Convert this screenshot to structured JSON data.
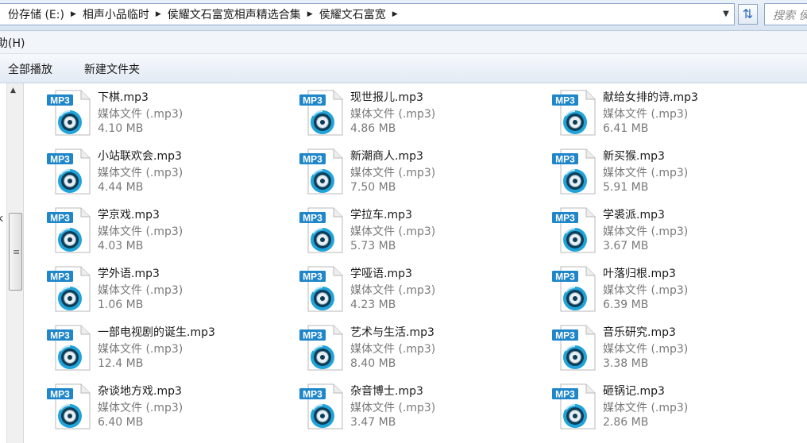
{
  "address_bar": {
    "crumbs": [
      "份存储 (E:)",
      "相声小品临时",
      "侯耀文石富宽相声精选合集",
      "侯耀文石富宽"
    ],
    "search_placeholder": "搜索 侯"
  },
  "menu": {
    "help_label": "助(H)"
  },
  "toolbar": {
    "play_all": "全部播放",
    "new_folder": "新建文件夹"
  },
  "nav_pane": {
    "edge_char": "k"
  },
  "icons": {
    "file_icon": "mp3-file-icon",
    "badge_text": "MP3",
    "badge_color": "#1f86c9",
    "disc_color": "#1fa3d8"
  },
  "files": [
    {
      "name": "下棋.mp3",
      "type": "媒体文件 (.mp3)",
      "size": "4.10 MB"
    },
    {
      "name": "现世报儿.mp3",
      "type": "媒体文件 (.mp3)",
      "size": "4.86 MB"
    },
    {
      "name": "献给女排的诗.mp3",
      "type": "媒体文件 (.mp3)",
      "size": "6.41 MB"
    },
    {
      "name": "小站联欢会.mp3",
      "type": "媒体文件 (.mp3)",
      "size": "4.44 MB"
    },
    {
      "name": "新潮商人.mp3",
      "type": "媒体文件 (.mp3)",
      "size": "7.50 MB"
    },
    {
      "name": "新买猴.mp3",
      "type": "媒体文件 (.mp3)",
      "size": "5.91 MB"
    },
    {
      "name": "学京戏.mp3",
      "type": "媒体文件 (.mp3)",
      "size": "4.03 MB"
    },
    {
      "name": "学拉车.mp3",
      "type": "媒体文件 (.mp3)",
      "size": "5.73 MB"
    },
    {
      "name": "学裘派.mp3",
      "type": "媒体文件 (.mp3)",
      "size": "3.67 MB"
    },
    {
      "name": "学外语.mp3",
      "type": "媒体文件 (.mp3)",
      "size": "1.06 MB"
    },
    {
      "name": "学哑语.mp3",
      "type": "媒体文件 (.mp3)",
      "size": "4.23 MB"
    },
    {
      "name": "叶落归根.mp3",
      "type": "媒体文件 (.mp3)",
      "size": "6.39 MB"
    },
    {
      "name": "一部电视剧的诞生.mp3",
      "type": "媒体文件 (.mp3)",
      "size": "12.4 MB"
    },
    {
      "name": "艺术与生活.mp3",
      "type": "媒体文件 (.mp3)",
      "size": "8.40 MB"
    },
    {
      "name": "音乐研究.mp3",
      "type": "媒体文件 (.mp3)",
      "size": "3.38 MB"
    },
    {
      "name": "杂谈地方戏.mp3",
      "type": "媒体文件 (.mp3)",
      "size": "6.40 MB"
    },
    {
      "name": "杂音博士.mp3",
      "type": "媒体文件 (.mp3)",
      "size": "3.47 MB"
    },
    {
      "name": "砸锅记.mp3",
      "type": "媒体文件 (.mp3)",
      "size": "2.86 MB"
    }
  ]
}
